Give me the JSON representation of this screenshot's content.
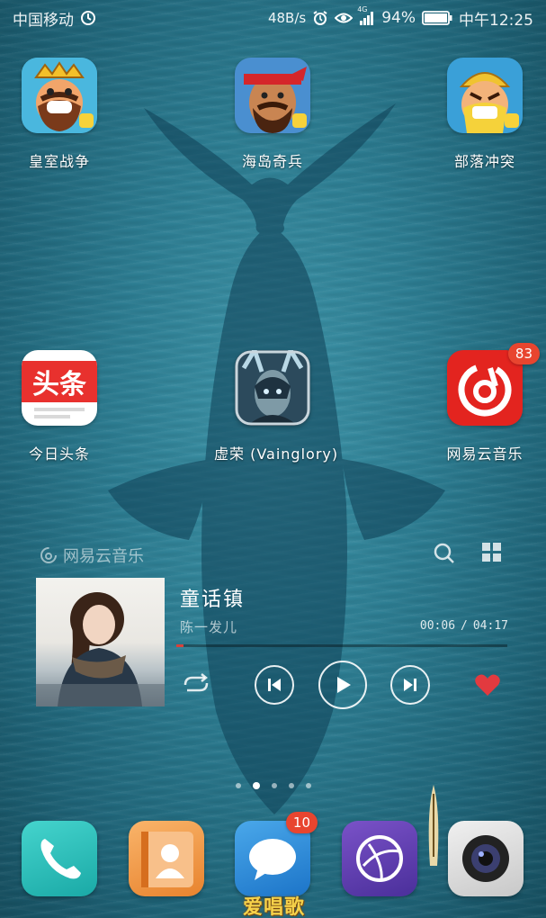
{
  "status_bar": {
    "carrier": "中国移动",
    "network_speed": "48B/s",
    "network_type": "4G",
    "battery": "94%",
    "time": "中午12:25"
  },
  "apps": [
    {
      "label": "皇室战争",
      "icon": "clash-royale-icon"
    },
    {
      "label": "海岛奇兵",
      "icon": "boom-beach-icon"
    },
    {
      "label": "部落冲突",
      "icon": "clash-of-clans-icon"
    },
    {
      "label": "今日头条",
      "icon": "toutiao-icon",
      "icon_text": "头条"
    },
    {
      "label": "虚荣 (Vainglory)",
      "icon": "vainglory-icon"
    },
    {
      "label": "网易云音乐",
      "icon": "netease-music-icon",
      "badge": "83"
    }
  ],
  "music_widget": {
    "brand": "网易云音乐",
    "song_title": "童话镇",
    "artist": "陈一发儿",
    "elapsed": "00:06",
    "duration": "04:17",
    "progress": 0.023,
    "icons": [
      "search-icon",
      "grid-icon",
      "repeat-icon",
      "previous-icon",
      "play-icon",
      "next-icon",
      "heart-icon"
    ]
  },
  "pager": {
    "pages": 5,
    "active": 2
  },
  "dock": [
    {
      "icon": "phone-icon"
    },
    {
      "icon": "contacts-icon"
    },
    {
      "icon": "messages-icon",
      "badge": "10"
    },
    {
      "icon": "browser-icon"
    },
    {
      "icon": "camera-icon"
    }
  ],
  "watermark": "爱唱歌",
  "colors": {
    "accent_red": "#e8452f",
    "progress_red": "#d8413a",
    "ocean": "#2d7e93"
  }
}
